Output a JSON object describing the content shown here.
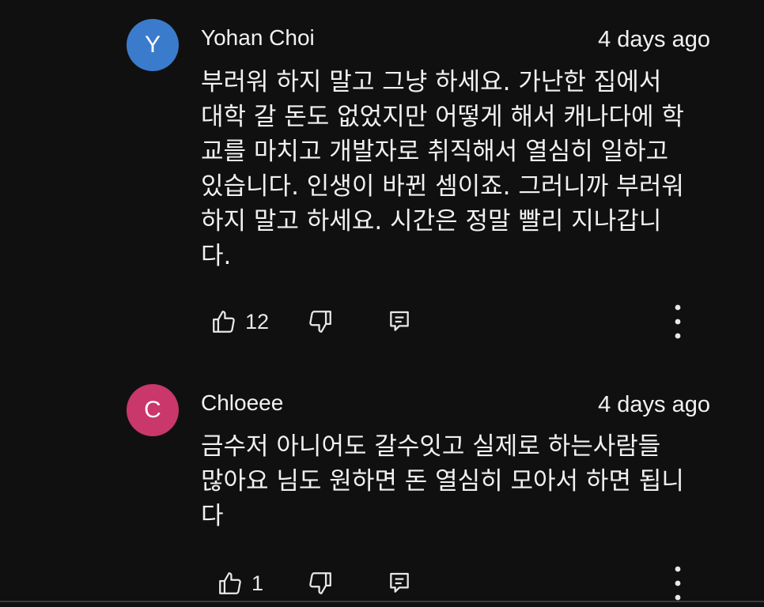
{
  "colors": {
    "background": "#101010",
    "text": "#f1f1f1",
    "avatar_y": "#3b7bcb",
    "avatar_c": "#c9376b"
  },
  "comments": [
    {
      "avatar_letter": "Y",
      "author": "Yohan Choi",
      "timestamp": "4 days ago",
      "lines": [
        "부러워 하지 말고 그냥 하세요. 가난한 집에서",
        "대학 갈 돈도 없었지만 어떻게 해서 캐나다에 학",
        "교를 마치고 개발자로 취직해서 열심히 일하고",
        "있습니다. 인생이 바뀐 셈이죠. 그러니까 부러워",
        "하지 말고 하세요. 시간은 정말 빨리 지나갑니",
        "다."
      ],
      "like_count": "12",
      "icons": [
        "thumbs-up-icon",
        "thumbs-down-icon",
        "reply-icon",
        "more-vert-icon"
      ]
    },
    {
      "avatar_letter": "C",
      "author": "Chloeee",
      "timestamp": "4 days ago",
      "lines": [
        "금수저 아니어도 갈수잇고 실제로 하는사람들",
        "많아요 님도 원하면 돈 열심히 모아서 하면 됩니",
        "다"
      ],
      "like_count": "1",
      "icons": [
        "thumbs-up-icon",
        "thumbs-down-icon",
        "reply-icon",
        "more-vert-icon"
      ]
    }
  ]
}
